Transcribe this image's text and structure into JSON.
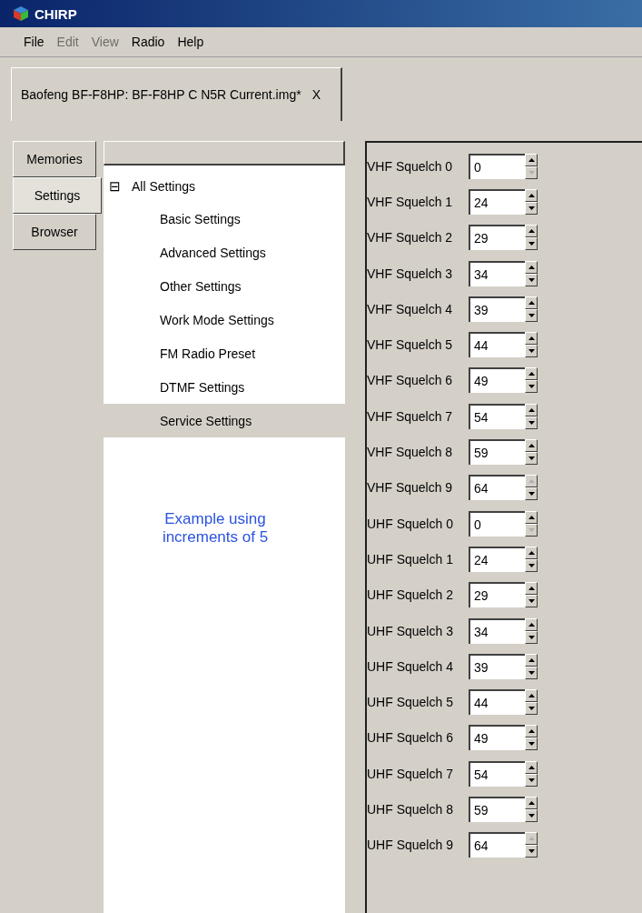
{
  "window": {
    "title": "CHIRP"
  },
  "menu": [
    {
      "label": "File",
      "disabled": false
    },
    {
      "label": "Edit",
      "disabled": true
    },
    {
      "label": "View",
      "disabled": true
    },
    {
      "label": "Radio",
      "disabled": false
    },
    {
      "label": "Help",
      "disabled": false
    }
  ],
  "document_tab": {
    "label": "Baofeng BF-F8HP: BF-F8HP C N5R Current.img*",
    "close": "X"
  },
  "side_tabs": [
    {
      "label": "Memories",
      "selected": false
    },
    {
      "label": "Settings",
      "selected": true
    },
    {
      "label": "Browser",
      "selected": false
    }
  ],
  "tree": {
    "root": {
      "label": "All Settings",
      "expander": "⊟",
      "children": [
        {
          "label": "Basic Settings",
          "selected": false
        },
        {
          "label": "Advanced Settings",
          "selected": false
        },
        {
          "label": "Other Settings",
          "selected": false
        },
        {
          "label": "Work Mode Settings",
          "selected": false
        },
        {
          "label": "FM Radio Preset",
          "selected": false
        },
        {
          "label": "DTMF Settings",
          "selected": false
        },
        {
          "label": "Service Settings",
          "selected": true
        }
      ]
    }
  },
  "note": "Example using increments of 5",
  "settings": [
    {
      "label": "VHF Squelch 0",
      "value": "0",
      "up_enabled": true,
      "down_enabled": false
    },
    {
      "label": "VHF Squelch 1",
      "value": "24",
      "up_enabled": true,
      "down_enabled": true
    },
    {
      "label": "VHF Squelch 2",
      "value": "29",
      "up_enabled": true,
      "down_enabled": true
    },
    {
      "label": "VHF Squelch 3",
      "value": "34",
      "up_enabled": true,
      "down_enabled": true
    },
    {
      "label": "VHF Squelch 4",
      "value": "39",
      "up_enabled": true,
      "down_enabled": true
    },
    {
      "label": "VHF Squelch 5",
      "value": "44",
      "up_enabled": true,
      "down_enabled": true
    },
    {
      "label": "VHF Squelch 6",
      "value": "49",
      "up_enabled": true,
      "down_enabled": true
    },
    {
      "label": "VHF Squelch 7",
      "value": "54",
      "up_enabled": true,
      "down_enabled": true
    },
    {
      "label": "VHF Squelch 8",
      "value": "59",
      "up_enabled": true,
      "down_enabled": true
    },
    {
      "label": "VHF Squelch 9",
      "value": "64",
      "up_enabled": false,
      "down_enabled": true
    },
    {
      "label": "UHF Squelch 0",
      "value": "0",
      "up_enabled": true,
      "down_enabled": false
    },
    {
      "label": "UHF Squelch 1",
      "value": "24",
      "up_enabled": true,
      "down_enabled": true
    },
    {
      "label": "UHF Squelch 2",
      "value": "29",
      "up_enabled": true,
      "down_enabled": true
    },
    {
      "label": "UHF Squelch 3",
      "value": "34",
      "up_enabled": true,
      "down_enabled": true
    },
    {
      "label": "UHF Squelch 4",
      "value": "39",
      "up_enabled": true,
      "down_enabled": true
    },
    {
      "label": "UHF Squelch 5",
      "value": "44",
      "up_enabled": true,
      "down_enabled": true
    },
    {
      "label": "UHF Squelch 6",
      "value": "49",
      "up_enabled": true,
      "down_enabled": true
    },
    {
      "label": "UHF Squelch 7",
      "value": "54",
      "up_enabled": true,
      "down_enabled": true
    },
    {
      "label": "UHF Squelch 8",
      "value": "59",
      "up_enabled": true,
      "down_enabled": true
    },
    {
      "label": "UHF Squelch 9",
      "value": "64",
      "up_enabled": false,
      "down_enabled": true
    }
  ]
}
